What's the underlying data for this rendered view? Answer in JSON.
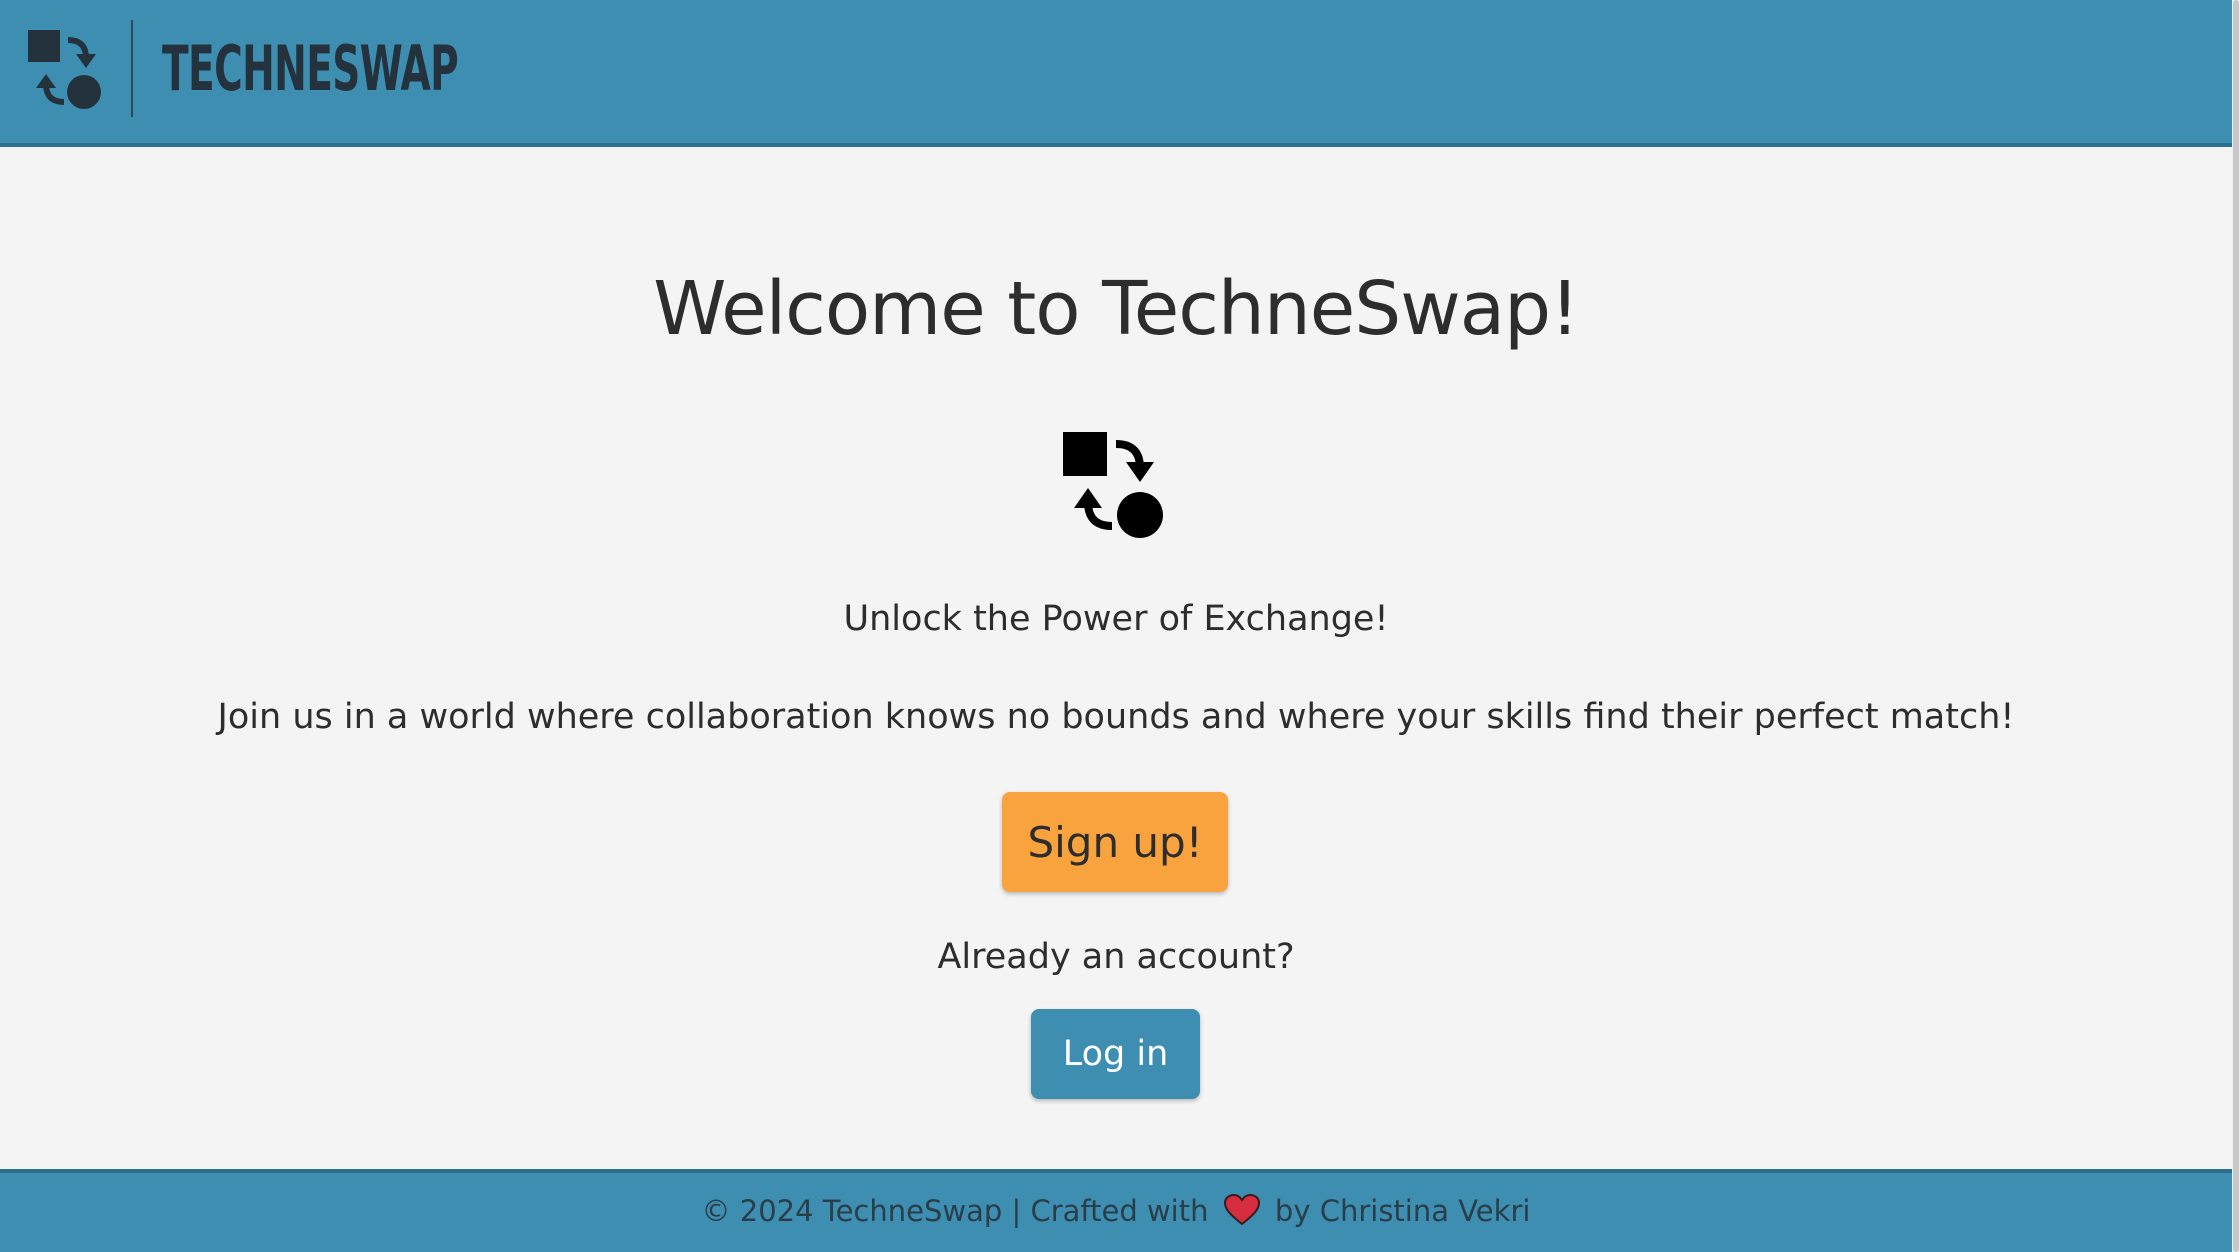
{
  "header": {
    "brand": "TECHNESWAP",
    "logo_icon": "swap-shapes-icon"
  },
  "main": {
    "title": "Welcome to TechneSwap!",
    "hero_icon": "swap-shapes-icon",
    "tagline": "Unlock the Power of Exchange!",
    "description": "Join us in a world where collaboration knows no bounds and where your skills find their perfect match!",
    "signup_label": "Sign up!",
    "already_text": "Already an account?",
    "login_label": "Log in"
  },
  "footer": {
    "text_before": "© 2024 TechneSwap | Crafted with",
    "heart_icon": "heart-icon",
    "text_after": "by Christina Vekri"
  },
  "colors": {
    "brand_blue": "#3d8eb1",
    "signup_orange": "#f8a33e",
    "heart_red": "#d62d3f",
    "background": "#f4f4f4"
  }
}
